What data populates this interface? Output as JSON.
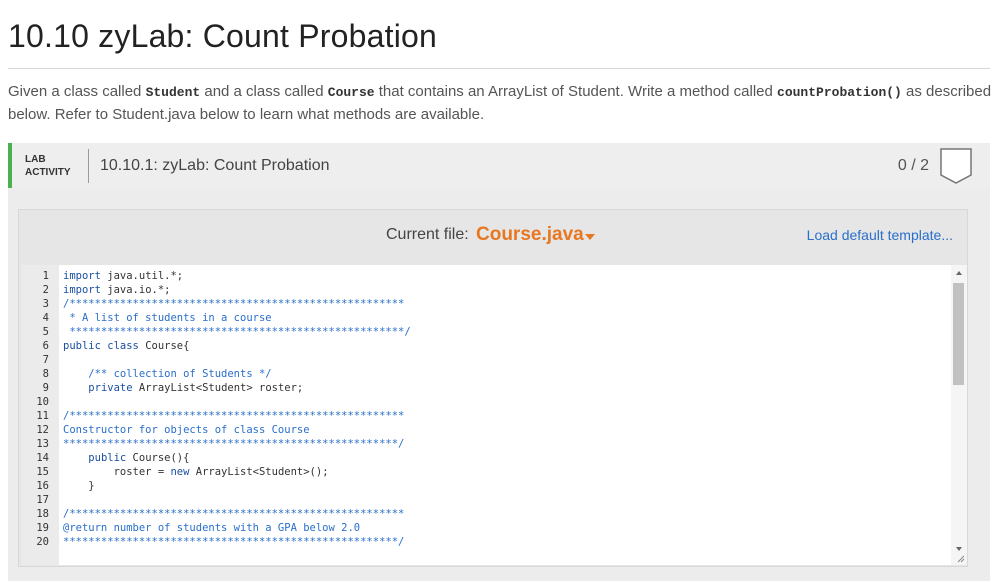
{
  "page": {
    "title": "10.10 zyLab: Count Probation"
  },
  "description": {
    "part1": "Given a class called ",
    "code1": "Student",
    "part2": " and a class called ",
    "code2": "Course",
    "part3": " that contains an ArrayList of Student. Write a method called ",
    "code3": "countProbation()",
    "part4": " as described below. Refer to Student.java below to learn what methods are available."
  },
  "lab": {
    "label_line1": "LAB",
    "label_line2": "ACTIVITY",
    "name": "10.10.1: zyLab: Count Probation",
    "score": "0 / 2",
    "accent_color": "#4caf50"
  },
  "editor": {
    "current_file_label": "Current file:",
    "current_file_name": "Course.java",
    "load_template_label": "Load default template...",
    "file_color": "#e87722",
    "link_color": "#2a6fc9"
  },
  "code_lines": [
    {
      "n": "1",
      "text": "import java.util.*;"
    },
    {
      "n": "2",
      "text": "import java.io.*;"
    },
    {
      "n": "3",
      "text": "/*****************************************************"
    },
    {
      "n": "4",
      "text": " * A list of students in a course"
    },
    {
      "n": "5",
      "text": " *****************************************************/"
    },
    {
      "n": "6",
      "text": "public class Course{"
    },
    {
      "n": "7",
      "text": ""
    },
    {
      "n": "8",
      "text": "    /** collection of Students */"
    },
    {
      "n": "9",
      "text": "    private ArrayList<Student> roster;"
    },
    {
      "n": "10",
      "text": ""
    },
    {
      "n": "11",
      "text": "/*****************************************************"
    },
    {
      "n": "12",
      "text": "Constructor for objects of class Course"
    },
    {
      "n": "13",
      "text": "*****************************************************/"
    },
    {
      "n": "14",
      "text": "    public Course(){"
    },
    {
      "n": "15",
      "text": "        roster = new ArrayList<Student>();"
    },
    {
      "n": "16",
      "text": "    }"
    },
    {
      "n": "17",
      "text": ""
    },
    {
      "n": "18",
      "text": "/*****************************************************"
    },
    {
      "n": "19",
      "text": "@return number of students with a GPA below 2.0"
    },
    {
      "n": "20",
      "text": "*****************************************************/"
    }
  ]
}
